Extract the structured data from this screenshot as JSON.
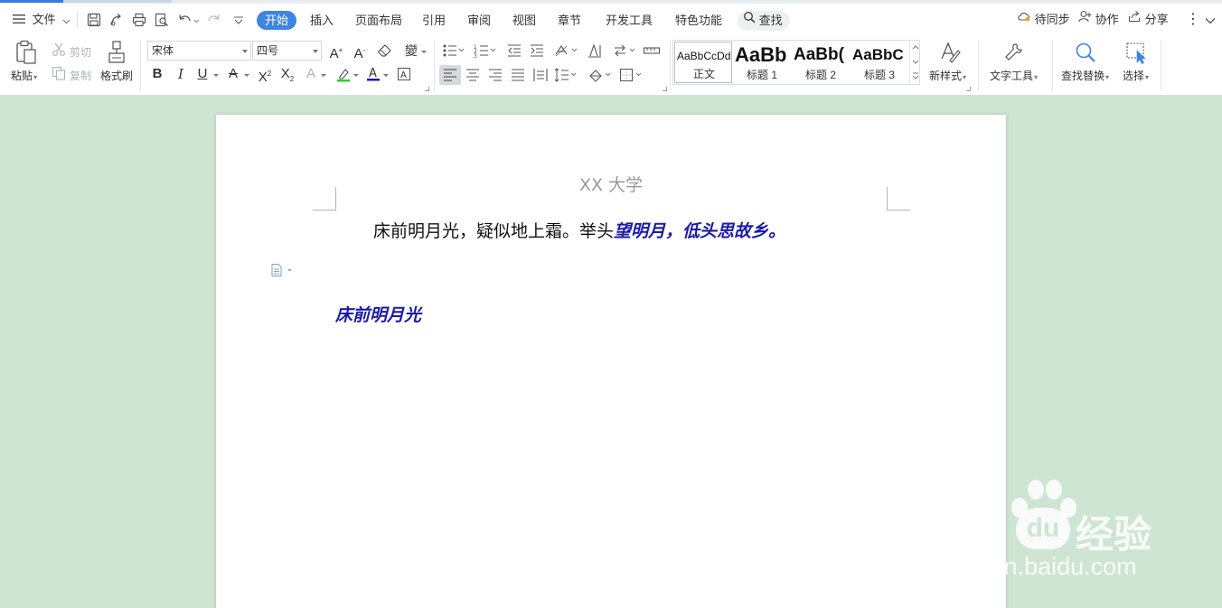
{
  "menubar": {
    "file_label": "文件",
    "tabs": [
      {
        "label": "开始",
        "active": true
      },
      {
        "label": "插入"
      },
      {
        "label": "页面布局"
      },
      {
        "label": "引用"
      },
      {
        "label": "审阅"
      },
      {
        "label": "视图"
      },
      {
        "label": "章节"
      },
      {
        "label": "开发工具"
      },
      {
        "label": "特色功能"
      }
    ],
    "search_label": "查找",
    "right": {
      "sync": "待同步",
      "collab": "协作",
      "share": "分享"
    }
  },
  "ribbon": {
    "paste": "粘贴",
    "cut": "剪切",
    "copy": "复制",
    "format_painter": "格式刷",
    "font_name": "宋体",
    "font_size": "四号",
    "styles": [
      {
        "preview": "AaBbCcDd",
        "name": "正文"
      },
      {
        "preview": "AaBb",
        "name": "标题 1"
      },
      {
        "preview": "AaBb(",
        "name": "标题 2"
      },
      {
        "preview": "AaBbC",
        "name": "标题 3"
      }
    ],
    "new_style": "新样式",
    "text_tools": "文字工具",
    "find_replace": "查找替换",
    "select": "选择"
  },
  "document": {
    "header": "XX 大学",
    "line1_plain": "床前明月光，疑似地上霜。举头",
    "line1_formatted": "望明月，低头思故乡。",
    "line2": "床前明月光"
  },
  "watermark": {
    "brand_left": "Bai",
    "brand_right": "经验",
    "url": "jingyan.baidu.com"
  },
  "colors": {
    "accent": "#3d85e0",
    "text_blue": "#1a1aa8",
    "background": "#cfe5d3"
  }
}
